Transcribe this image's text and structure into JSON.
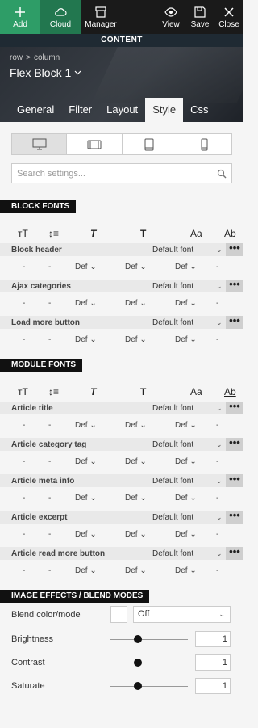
{
  "toolbar": {
    "add": "Add",
    "cloud": "Cloud",
    "manager": "Manager",
    "view": "View",
    "save": "Save",
    "close": "Close"
  },
  "section_strip": "CONTENT",
  "breadcrumb": {
    "row": "row",
    "sep": ">",
    "column": "column"
  },
  "block_title": "Flex Block 1",
  "tabs": [
    "General",
    "Filter",
    "Layout",
    "Style",
    "Css"
  ],
  "active_tab": "Style",
  "search_placeholder": "Search settings...",
  "block_fonts": {
    "label": "BLOCK FONTS",
    "rows": [
      {
        "name": "Block header",
        "font": "Default font"
      },
      {
        "name": "Ajax categories",
        "font": "Default font"
      },
      {
        "name": "Load more button",
        "font": "Default font"
      }
    ]
  },
  "module_fonts": {
    "label": "MODULE FONTS",
    "rows": [
      {
        "name": "Article title",
        "font": "Default font"
      },
      {
        "name": "Article category tag",
        "font": "Default font"
      },
      {
        "name": "Article meta info",
        "font": "Default font"
      },
      {
        "name": "Article excerpt",
        "font": "Default font"
      },
      {
        "name": "Article read more button",
        "font": "Default font"
      }
    ]
  },
  "value_row": {
    "dash": "-",
    "def": "Def"
  },
  "icons": {
    "size": "тT",
    "lineheight": "↕≡",
    "style": "T",
    "weight": "T",
    "transform": "Aa",
    "spacing": "Ab"
  },
  "more": "•••",
  "image_effects": {
    "label": "IMAGE EFFECTS / BLEND MODES",
    "blend_label": "Blend color/mode",
    "blend_value": "Off",
    "brightness_label": "Brightness",
    "brightness_value": "1",
    "contrast_label": "Contrast",
    "contrast_value": "1",
    "saturate_label": "Saturate",
    "saturate_value": "1"
  }
}
